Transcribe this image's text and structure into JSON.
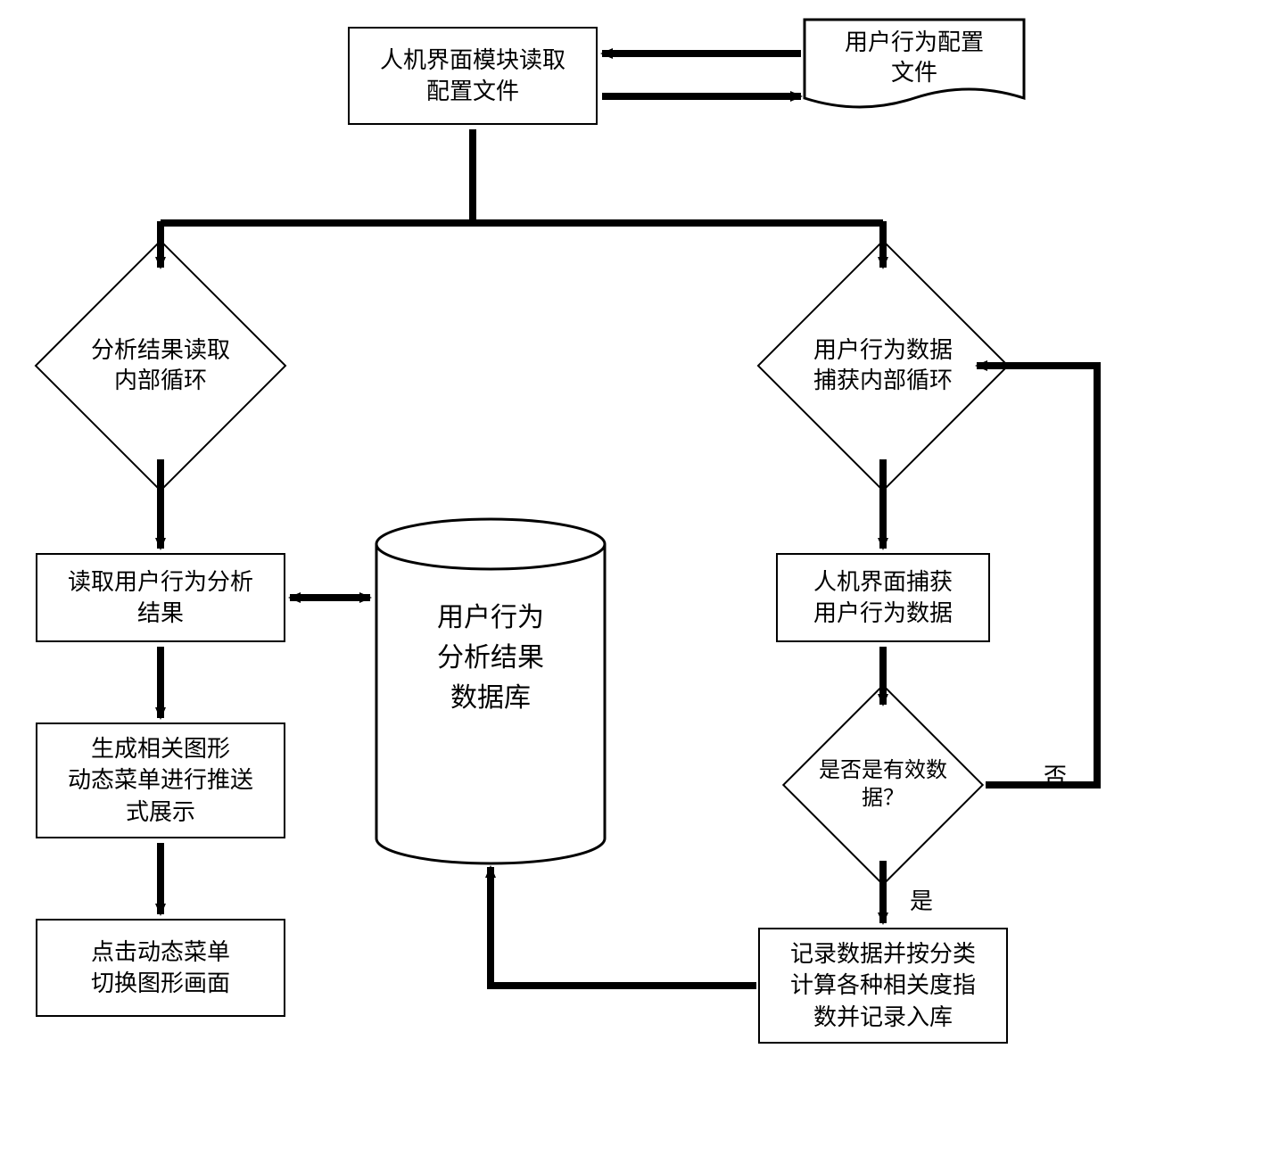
{
  "top": {
    "readConfig": "人机界面模块读取\n配置文件",
    "configFile": "用户行为配置\n文件"
  },
  "left": {
    "loop": "分析结果读取\n内部循环",
    "readResult": "读取用户行为分析\n结果",
    "genMenu": "生成相关图形\n动态菜单进行推送\n式展示",
    "clickMenu": "点击动态菜单\n切换图形画面"
  },
  "center": {
    "db": "用户行为\n分析结果\n数据库"
  },
  "right": {
    "loop": "用户行为数据\n捕获内部循环",
    "capture": "人机界面捕获\n用户行为数据",
    "valid": "是否是有效数\n据？",
    "record": "记录数据并按分类\n计算各种相关度指\n数并记录入库",
    "yes": "是",
    "no": "否"
  }
}
